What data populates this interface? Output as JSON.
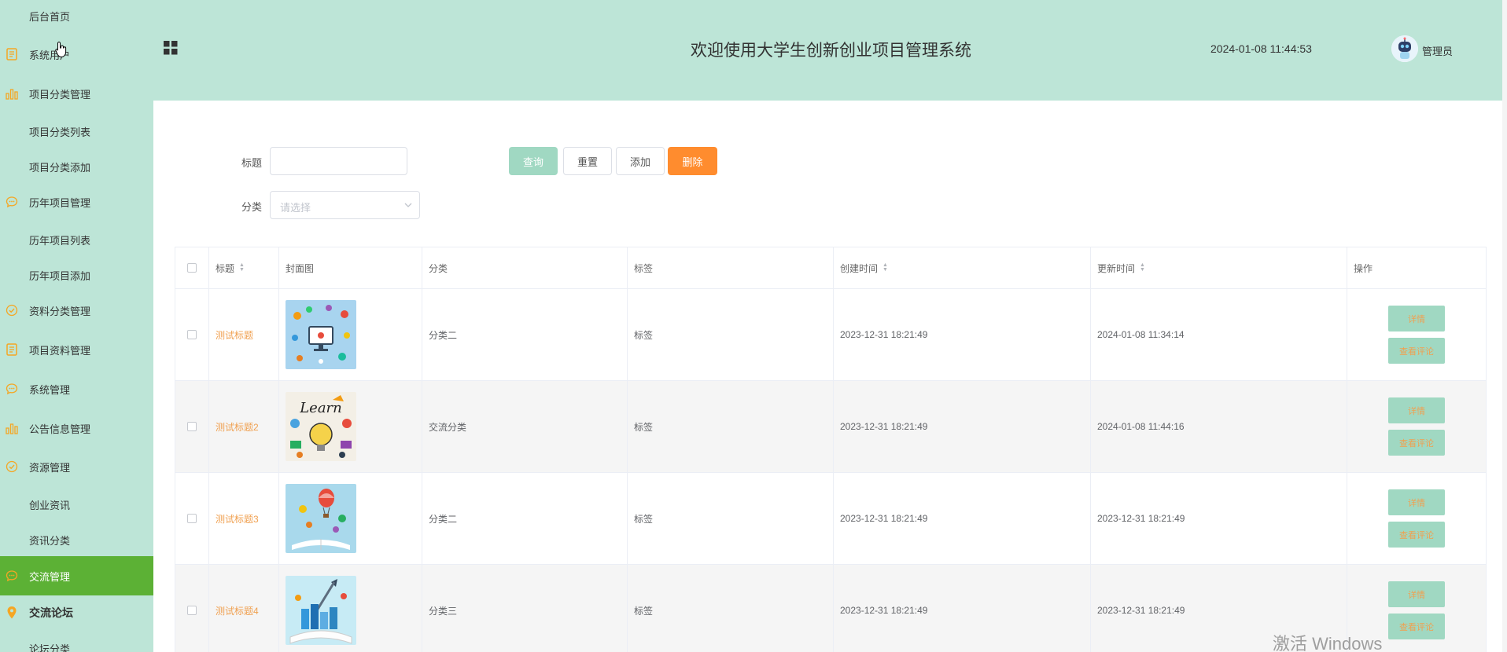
{
  "sidebar": {
    "items": [
      {
        "label": "后台首页",
        "icon": "none"
      },
      {
        "label": "系统用户",
        "icon": "document-icon"
      },
      {
        "label": "项目分类管理",
        "icon": "bar-chart-icon"
      },
      {
        "label": "项目分类列表",
        "icon": "none"
      },
      {
        "label": "项目分类添加",
        "icon": "none"
      },
      {
        "label": "历年项目管理",
        "icon": "chat-icon"
      },
      {
        "label": "历年项目列表",
        "icon": "none"
      },
      {
        "label": "历年项目添加",
        "icon": "none"
      },
      {
        "label": "资料分类管理",
        "icon": "check-circle-icon"
      },
      {
        "label": "项目资料管理",
        "icon": "document-icon"
      },
      {
        "label": "系统管理",
        "icon": "chat-icon"
      },
      {
        "label": "公告信息管理",
        "icon": "bar-chart-icon"
      },
      {
        "label": "资源管理",
        "icon": "check-circle-icon"
      },
      {
        "label": "创业资讯",
        "icon": "none"
      },
      {
        "label": "资讯分类",
        "icon": "none"
      },
      {
        "label": "交流管理",
        "icon": "chat-icon"
      },
      {
        "label": "交流论坛",
        "icon": "location-pin-icon"
      },
      {
        "label": "论坛分类",
        "icon": "none"
      }
    ]
  },
  "header": {
    "title": "欢迎使用大学生创新创业项目管理系统",
    "datetime": "2024-01-08 11:44:53",
    "user": "管理员"
  },
  "search": {
    "title_label": "标题",
    "title_value": "",
    "category_label": "分类",
    "category_placeholder": "请选择",
    "query_button": "查询",
    "reset_button": "重置",
    "add_button": "添加",
    "delete_button": "删除"
  },
  "table": {
    "headers": {
      "title": "标题",
      "cover": "封面图",
      "category": "分类",
      "tag": "标签",
      "created": "创建时间",
      "updated": "更新时间",
      "actions": "操作"
    },
    "rows": [
      {
        "title": "测试标题",
        "category": "分类二",
        "tag": "标签",
        "created": "2023-12-31 18:21:49",
        "updated": "2024-01-08 11:34:14",
        "detail": "详情",
        "comments": "查看评论"
      },
      {
        "title": "测试标题2",
        "category": "交流分类",
        "tag": "标签",
        "created": "2023-12-31 18:21:49",
        "updated": "2024-01-08 11:44:16",
        "detail": "详情",
        "comments": "查看评论"
      },
      {
        "title": "测试标题3",
        "category": "分类二",
        "tag": "标签",
        "created": "2023-12-31 18:21:49",
        "updated": "2023-12-31 18:21:49",
        "detail": "详情",
        "comments": "查看评论"
      },
      {
        "title": "测试标题4",
        "category": "分类三",
        "tag": "标签",
        "created": "2023-12-31 18:21:49",
        "updated": "2023-12-31 18:21:49",
        "detail": "详情",
        "comments": "查看评论"
      }
    ]
  },
  "colors": {
    "sidebar_bg": "#bde5d7",
    "active_bg": "#5cb135",
    "icon_accent": "#f5a623",
    "primary_btn": "#a0d8c2",
    "danger_btn": "#ff8c2e",
    "link_text": "#f0a050"
  },
  "watermark": "激活 Windows"
}
